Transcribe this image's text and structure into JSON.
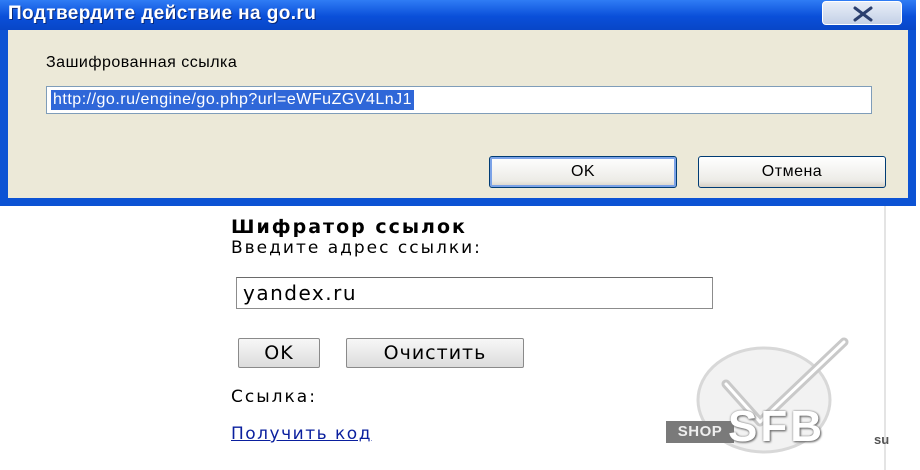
{
  "dialog": {
    "title": "Подтвердите действие на go.ru",
    "label": "Зашифрованная ссылка",
    "url_value": "http://go.ru/engine/go.php?url=eWFuZGV4LnJ1",
    "ok_label": "OK",
    "cancel_label": "Отмена",
    "close_icon": "close-icon"
  },
  "page": {
    "heading": "Шифратор ссылок",
    "prompt": "Введите адрес ссылки:",
    "address_value": "yandex.ru",
    "ok_label": "OK",
    "clear_label": "Очистить",
    "result_label": "Ссылка:",
    "get_code_link": "Получить код"
  },
  "watermark": {
    "shop": "SHOP",
    "sfb": "SFB",
    "su": "su"
  },
  "colors": {
    "titlebar": "#0a4fd9",
    "selection": "#2f67d8",
    "link": "#0a1f9e"
  }
}
